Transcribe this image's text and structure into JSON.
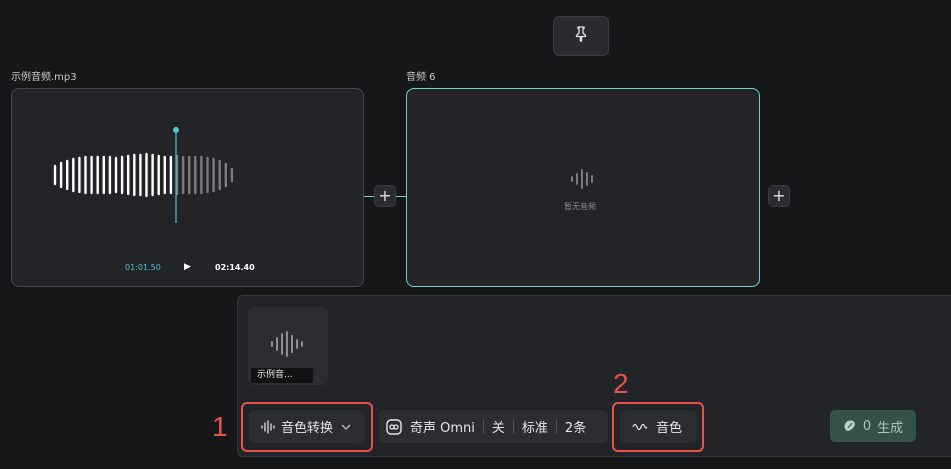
{
  "source": {
    "title": "示例音频.mp3",
    "current_time": "01:01.50",
    "total_time": "02:14.40",
    "play_icon": "▶"
  },
  "target": {
    "title": "音频 6",
    "empty_label": "暂无音频"
  },
  "panel": {
    "thumbnail_label": "示例音...",
    "convert_label": "音色转换",
    "model": {
      "name": "奇声 Omni",
      "toggle": "关",
      "quality": "标准",
      "count": "2条"
    },
    "timbre_label": "音色",
    "generate_count": "0",
    "generate_label": "生成"
  },
  "annotations": {
    "marker_1": "1",
    "marker_2": "2"
  },
  "colors": {
    "accent": "#6fd2d8",
    "annotation": "#e5534b",
    "generate_bg": "#35524a"
  }
}
